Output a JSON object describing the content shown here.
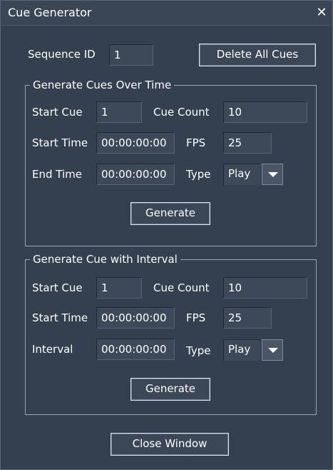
{
  "window": {
    "title": "Cue Generator",
    "close_glyph": "✕"
  },
  "header": {
    "sequence_label": "Sequence ID",
    "sequence_value": "1",
    "delete_all_label": "Delete All Cues"
  },
  "group_time": {
    "title": "Generate Cues Over Time",
    "start_cue_label": "Start Cue",
    "start_cue_value": "1",
    "cue_count_label": "Cue Count",
    "cue_count_value": "10",
    "start_time_label": "Start Time",
    "start_time_value": "00:00:00:00",
    "fps_label": "FPS",
    "fps_value": "25",
    "end_time_label": "End Time",
    "end_time_value": "00:00:00:00",
    "type_label": "Type",
    "type_value": "Play",
    "generate_label": "Generate"
  },
  "group_interval": {
    "title": "Generate Cue with Interval",
    "start_cue_label": "Start Cue",
    "start_cue_value": "1",
    "cue_count_label": "Cue Count",
    "cue_count_value": "10",
    "start_time_label": "Start Time",
    "start_time_value": "00:00:00:00",
    "fps_label": "FPS",
    "fps_value": "25",
    "interval_label": "Interval",
    "interval_value": "00:00:00:00",
    "type_label": "Type",
    "type_value": "Play",
    "generate_label": "Generate"
  },
  "footer": {
    "close_window_label": "Close Window"
  },
  "colors": {
    "background": "#34404f",
    "field": "#3d4858",
    "border": "#9aa4b2"
  },
  "icons": {
    "close": "close-icon",
    "dropdown": "chevron-down-icon"
  }
}
